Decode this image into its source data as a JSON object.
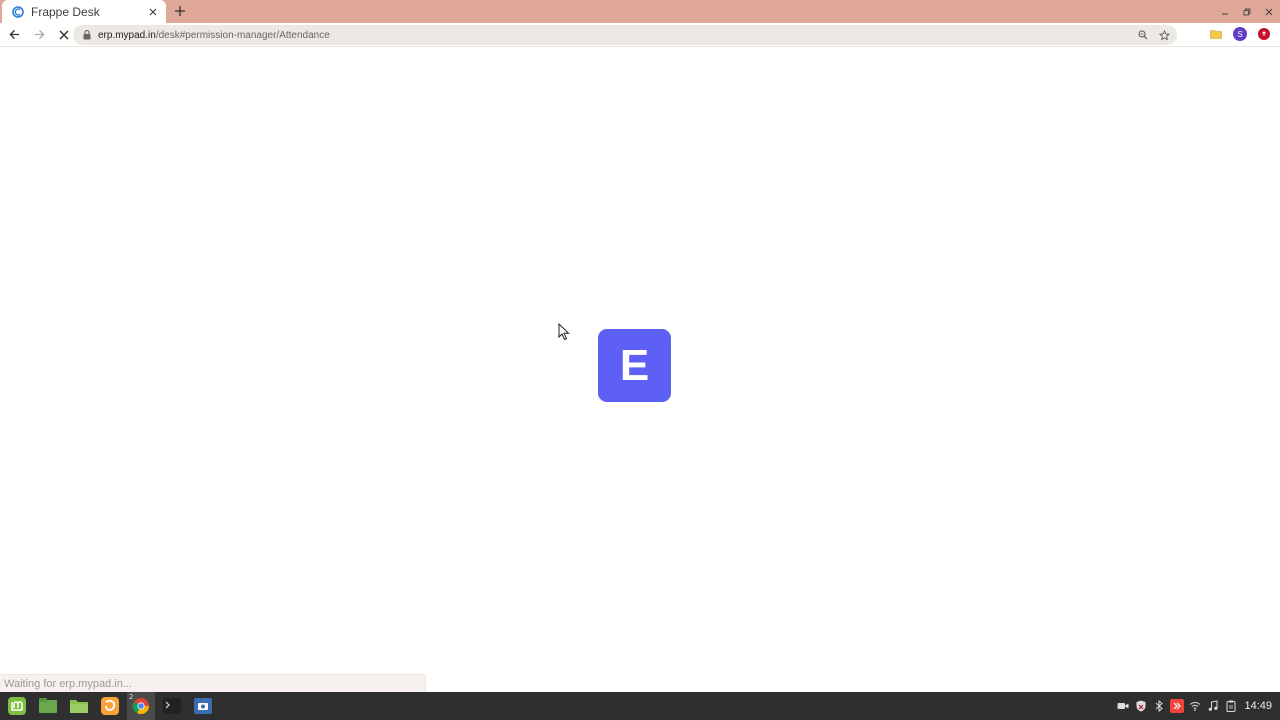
{
  "browser": {
    "tab": {
      "title": "Frappe Desk"
    },
    "url": {
      "host": "erp.mypad.in",
      "path": "/desk#permission-manager/Attendance"
    },
    "profile_initial": "S",
    "status_text": "Waiting for erp.mypad.in..."
  },
  "page": {
    "logo_letter": "E",
    "logo_color": "#5e5ff5"
  },
  "taskbar": {
    "chrome_window_count": "2",
    "clock": "14:49"
  }
}
